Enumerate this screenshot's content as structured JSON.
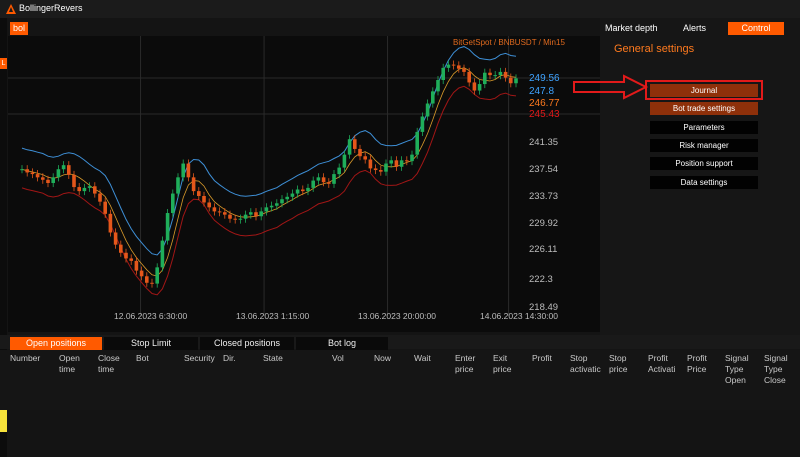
{
  "window": {
    "title": "BollingerRevers"
  },
  "bot_badge": "bol",
  "side_tab": "L",
  "chart": {
    "subtitle": "BitGetSpot / BNBUSDT / Min15",
    "price_labels": [
      {
        "value": "249.56",
        "color": "#3fa3ff"
      },
      {
        "value": "247.8",
        "color": "#3fa3ff"
      },
      {
        "value": "246.77",
        "color": "#ff7a1e"
      },
      {
        "value": "245.43",
        "color": "#e01818"
      }
    ],
    "y_ticks": [
      "241.35",
      "237.54",
      "233.73",
      "229.92",
      "226.11",
      "222.3",
      "218.49"
    ],
    "x_ticks": [
      "12.06.2023 6:30:00",
      "13.06.2023 1:15:00",
      "13.06.2023 20:00:00",
      "14.06.2023 14:30:00"
    ],
    "colors": {
      "up": "#1fae5a",
      "down": "#e4571b",
      "upper_band": "#3e8fd6",
      "lower_band": "#a11616",
      "middle": "#d99a2a"
    }
  },
  "chart_data": {
    "type": "candlestick",
    "title": "BitGetSpot / BNBUSDT / Min15",
    "ylim": [
      218.49,
      249.56
    ],
    "x_ticks": [
      "12.06.2023 6:30:00",
      "13.06.2023 1:15:00",
      "13.06.2023 20:00:00",
      "14.06.2023 14:30:00"
    ],
    "series": [
      {
        "name": "price",
        "values": [
          235.6,
          235.2,
          235.0,
          234.6,
          234.3,
          233.9,
          234.6,
          235.6,
          236.1,
          234.9,
          233.4,
          232.9,
          233.3,
          233.5,
          232.6,
          231.6,
          230.1,
          227.8,
          226.3,
          225.3,
          224.6,
          224.3,
          223.1,
          222.4,
          221.6,
          221.5,
          223.5,
          226.8,
          230.2,
          232.6,
          234.6,
          236.3,
          234.6,
          232.9,
          232.3,
          231.5,
          230.9,
          230.4,
          230.3,
          230.0,
          229.5,
          229.4,
          229.5,
          230.0,
          230.3,
          229.8,
          230.4,
          230.9,
          231.1,
          231.4,
          231.9,
          232.2,
          232.6,
          233.1,
          232.9,
          233.3,
          234.2,
          234.6,
          234.0,
          233.8,
          235.0,
          235.8,
          237.4,
          239.3,
          238.1,
          237.2,
          236.8,
          235.7,
          235.5,
          235.3,
          236.3,
          236.7,
          235.9,
          236.7,
          236.6,
          237.4,
          240.2,
          242.1,
          243.7,
          245.2,
          246.6,
          248.1,
          248.5,
          248.4,
          248.0,
          247.6,
          246.3,
          245.3,
          246.1,
          247.5,
          247.2,
          247.2,
          247.6,
          246.9,
          246.2,
          246.8
        ]
      }
    ]
  },
  "right_panel": {
    "tabs": [
      {
        "label": "Market depth"
      },
      {
        "label": "Alerts"
      },
      {
        "label": "Control"
      }
    ],
    "title": "General settings",
    "menu": [
      {
        "label": "Journal",
        "active": true
      },
      {
        "label": "Bot trade settings",
        "active": true
      },
      {
        "label": "Parameters",
        "active": false
      },
      {
        "label": "Risk manager",
        "active": false
      },
      {
        "label": "Position support",
        "active": false
      },
      {
        "label": "Data settings",
        "active": false
      }
    ]
  },
  "bottom_tabs": [
    {
      "label": "Open positions",
      "active": true
    },
    {
      "label": "Stop Limit",
      "active": false
    },
    {
      "label": "Closed positions",
      "active": false
    },
    {
      "label": "Bot log",
      "active": false
    }
  ],
  "columns": [
    "Number",
    "Open time",
    "Close time",
    "Bot",
    "Security",
    "Dir.",
    "State",
    "Vol",
    "Now",
    "Wait",
    "Enter price",
    "Exit price",
    "Profit",
    "Stop activatic",
    "Stop price",
    "Profit Activati",
    "Profit Price",
    "Signal Type Open",
    "Signal Type Close"
  ]
}
